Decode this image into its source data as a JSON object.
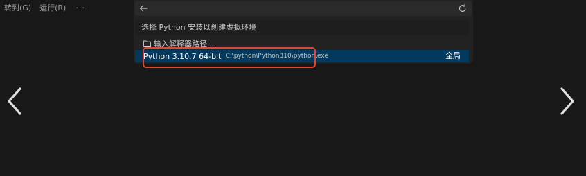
{
  "menubar": {
    "items": [
      "转到(G)",
      "运行(R)"
    ],
    "more": "···"
  },
  "quick_pick": {
    "back_icon": "arrow-left-icon",
    "refresh_icon": "refresh-icon",
    "title": "选择 Python 安装以创建虚拟环境",
    "enter_path": {
      "icon": "folder-icon",
      "label": "输入解释器路径..."
    },
    "selected_interpreter": {
      "name": "Python 3.10.7 64-bit",
      "path": "C:\\python\\Python310\\python.exe",
      "scope": "全局"
    }
  },
  "annotation": {
    "highlight_color": "#e0453a"
  },
  "viewer_nav": {
    "prev_icon": "chevron-left-icon",
    "next_icon": "chevron-right-icon"
  },
  "colors": {
    "background": "#181818",
    "selection": "#04395e"
  }
}
